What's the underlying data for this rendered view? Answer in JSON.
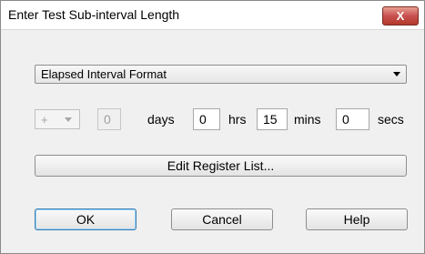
{
  "window": {
    "title": "Enter Test Sub-interval Length",
    "close_label": "X"
  },
  "format_select": {
    "value": "Elapsed Interval Format"
  },
  "interval": {
    "sign": "+",
    "days": {
      "value": "0",
      "unit": "days"
    },
    "hrs": {
      "value": "0",
      "unit": "hrs"
    },
    "mins": {
      "value": "15",
      "unit": "mins"
    },
    "secs": {
      "value": "0",
      "unit": "secs"
    }
  },
  "buttons": {
    "edit_register": "Edit Register List...",
    "ok": "OK",
    "cancel": "Cancel",
    "help": "Help"
  }
}
